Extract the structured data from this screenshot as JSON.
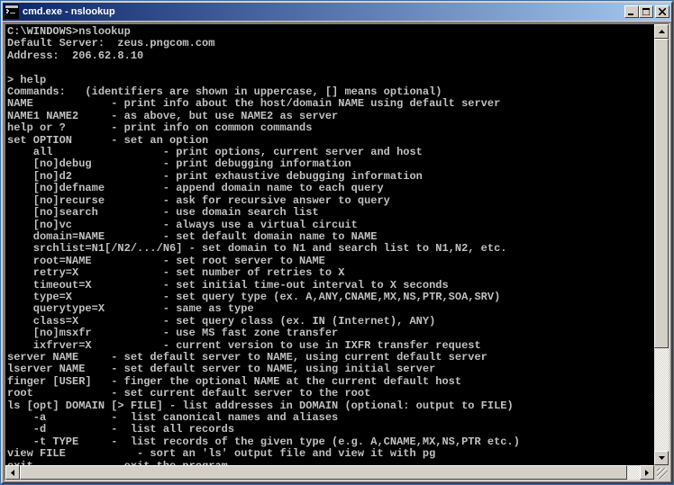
{
  "titlebar": {
    "title": "cmd.exe - nslookup"
  },
  "terminal": {
    "lines": [
      "C:\\WINDOWS>nslookup",
      "Default Server:  zeus.pngcom.com",
      "Address:  206.62.8.10",
      "",
      "> help",
      "Commands:   (identifiers are shown in uppercase, [] means optional)",
      "NAME            - print info about the host/domain NAME using default server",
      "NAME1 NAME2     - as above, but use NAME2 as server",
      "help or ?       - print info on common commands",
      "set OPTION      - set an option",
      "    all                 - print options, current server and host",
      "    [no]debug           - print debugging information",
      "    [no]d2              - print exhaustive debugging information",
      "    [no]defname         - append domain name to each query",
      "    [no]recurse         - ask for recursive answer to query",
      "    [no]search          - use domain search list",
      "    [no]vc              - always use a virtual circuit",
      "    domain=NAME         - set default domain name to NAME",
      "    srchlist=N1[/N2/.../N6] - set domain to N1 and search list to N1,N2, etc.",
      "    root=NAME           - set root server to NAME",
      "    retry=X             - set number of retries to X",
      "    timeout=X           - set initial time-out interval to X seconds",
      "    type=X              - set query type (ex. A,ANY,CNAME,MX,NS,PTR,SOA,SRV)",
      "    querytype=X         - same as type",
      "    class=X             - set query class (ex. IN (Internet), ANY)",
      "    [no]msxfr           - use MS fast zone transfer",
      "    ixfrver=X           - current version to use in IXFR transfer request",
      "server NAME     - set default server to NAME, using current default server",
      "lserver NAME    - set default server to NAME, using initial server",
      "finger [USER]   - finger the optional NAME at the current default host",
      "root            - set current default server to the root",
      "ls [opt] DOMAIN [> FILE] - list addresses in DOMAIN (optional: output to FILE)",
      "    -a          -  list canonical names and aliases",
      "    -d          -  list all records",
      "    -t TYPE     -  list records of the given type (e.g. A,CNAME,MX,NS,PTR etc.)",
      "view FILE           - sort an 'ls' output file and view it with pg",
      "exit            - exit the program",
      "> "
    ]
  },
  "scrollbar": {
    "vthumb_top_pct": 0,
    "vthumb_height_pct": 75,
    "hthumb_left_pct": 0,
    "hthumb_width_pct": 98
  }
}
